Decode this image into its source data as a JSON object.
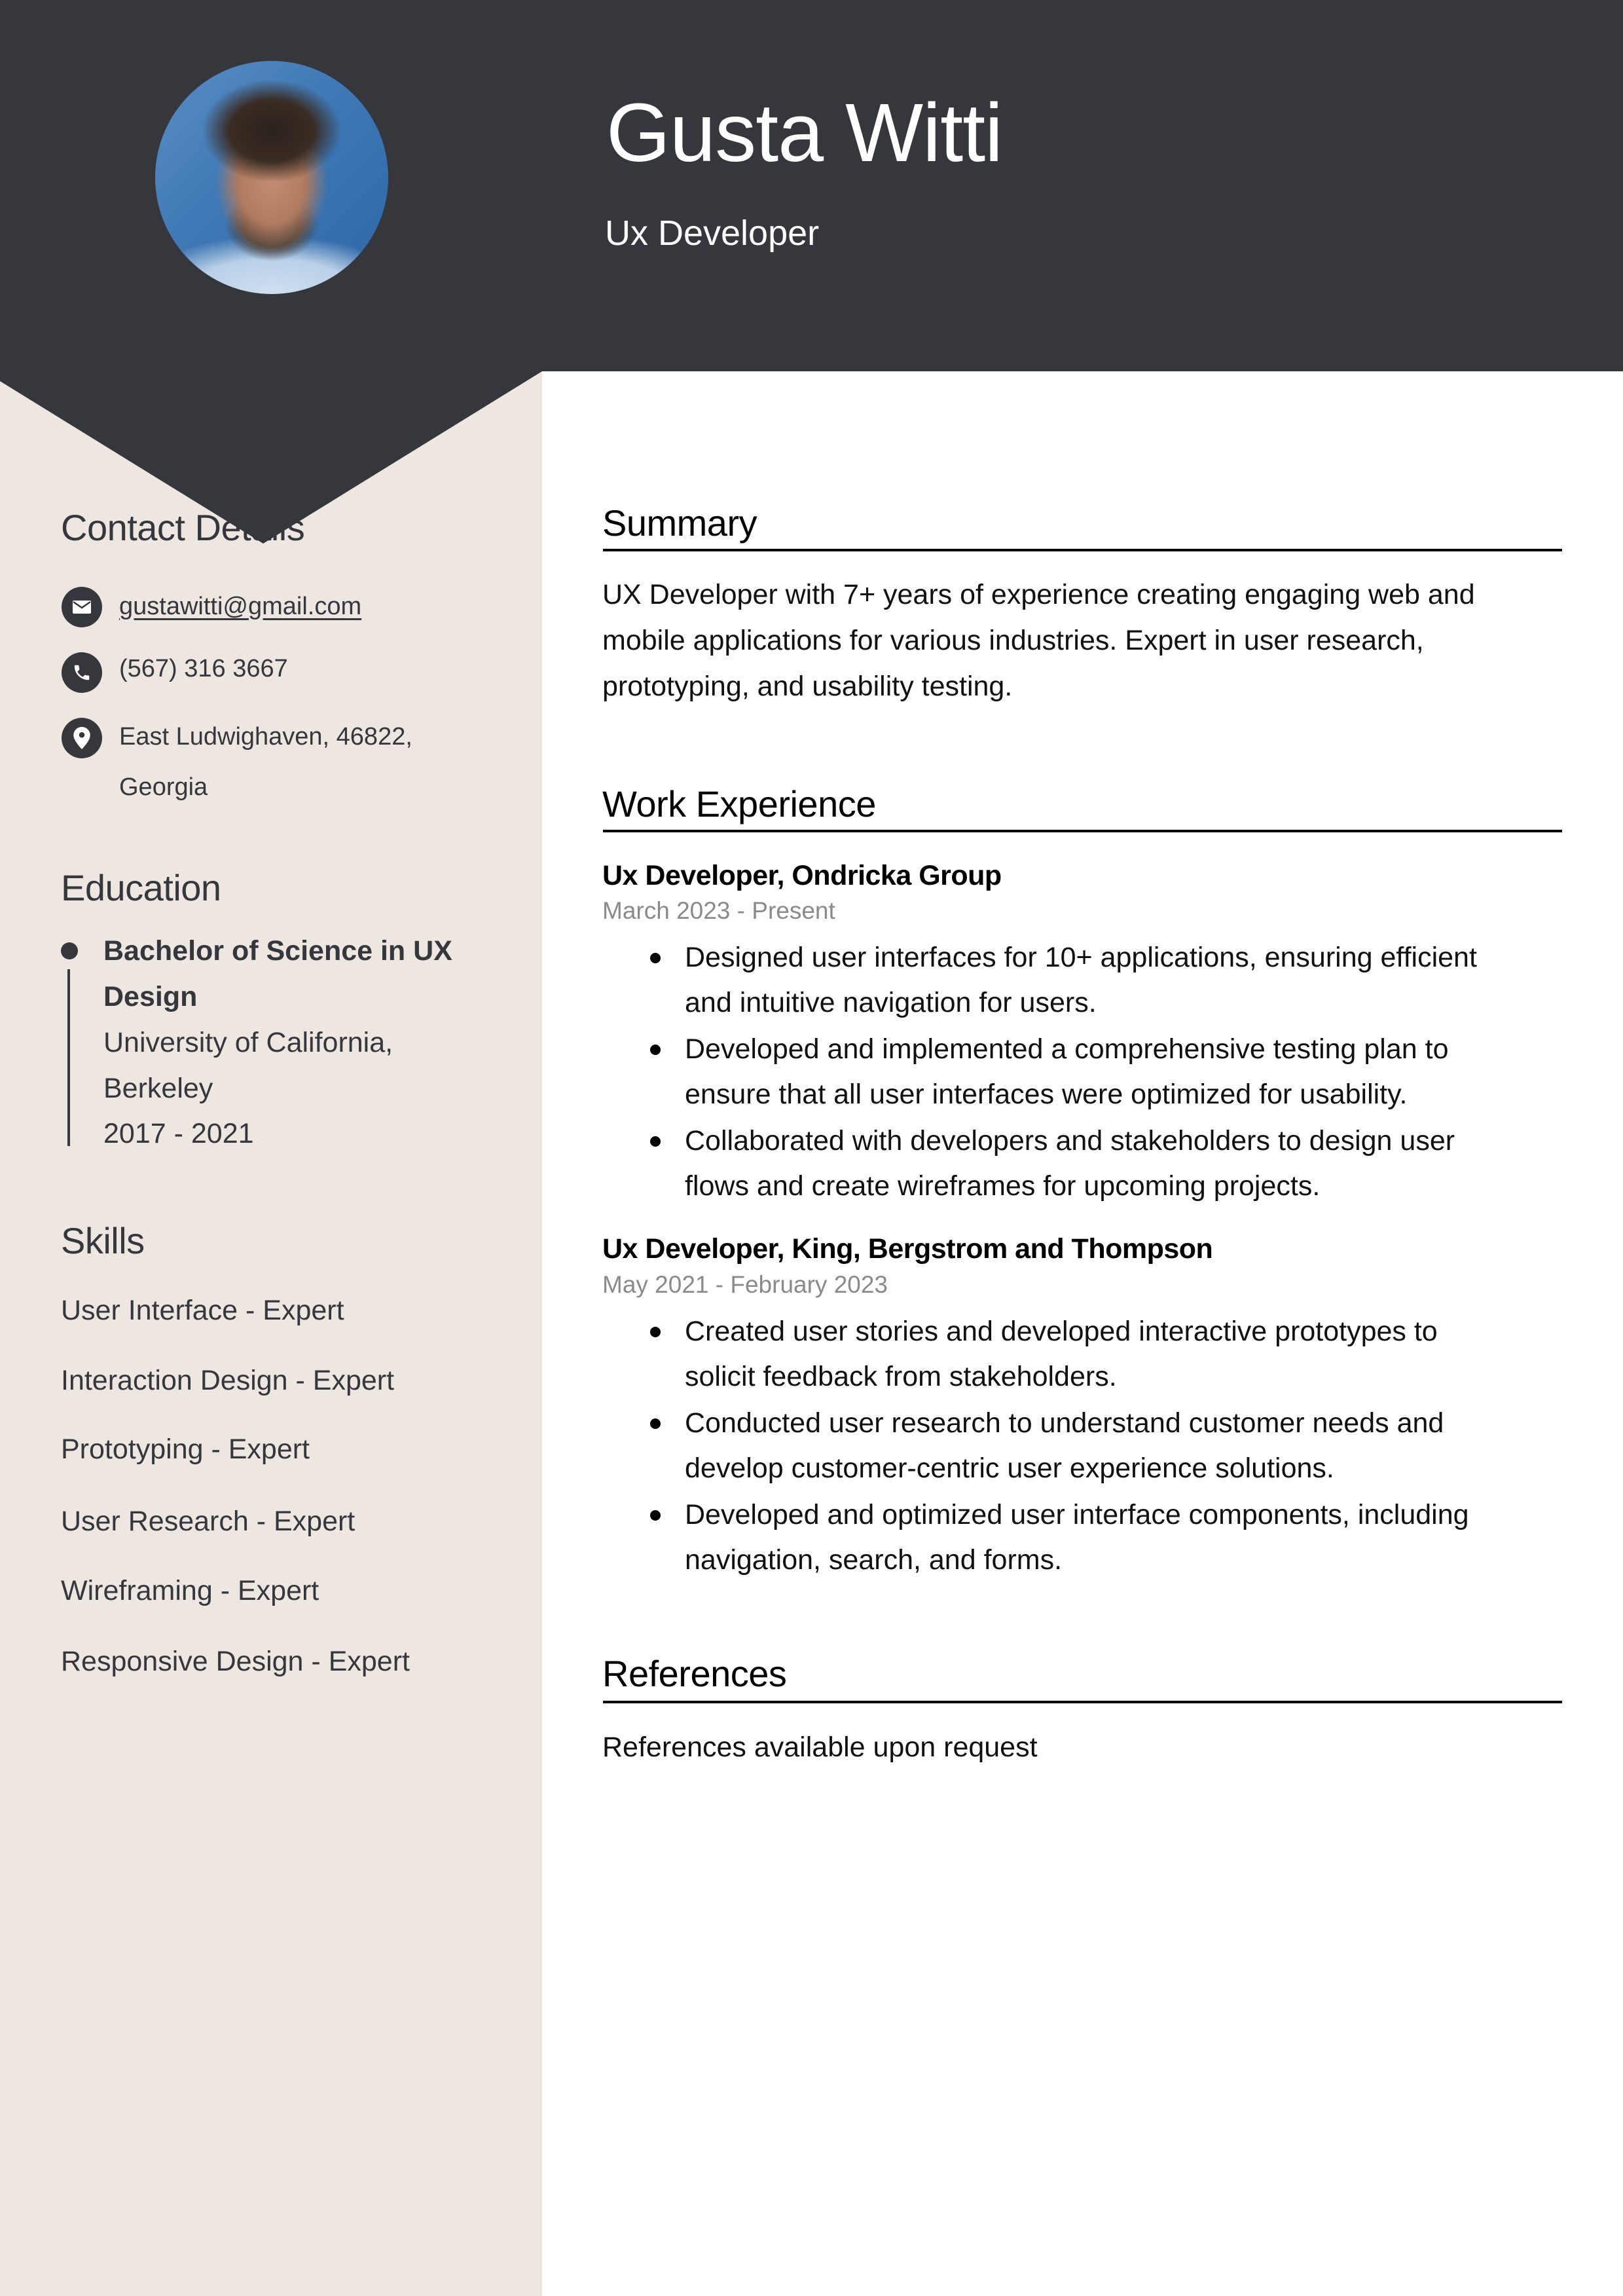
{
  "header": {
    "name": "Gusta Witti",
    "title": "Ux Developer",
    "photo_alt": "Profile photo of Gusta Witti"
  },
  "colors": {
    "header_bg": "#36373d",
    "sidebar_bg": "#ede6e1",
    "text_dark": "#36373d",
    "date_gray": "#8a8a8a"
  },
  "sidebar": {
    "contact": {
      "heading": "Contact Details",
      "items": [
        {
          "icon": "envelope-icon",
          "text": "gustawitti@gmail.com",
          "is_link": true
        },
        {
          "icon": "phone-icon",
          "text": "(567) 316 3667",
          "is_link": false
        },
        {
          "icon": "map-pin-icon",
          "lines": [
            "East Ludwighaven, 46822,",
            "Georgia"
          ],
          "is_link": false
        }
      ]
    },
    "education": {
      "heading": "Education",
      "entries": [
        {
          "degree_lines": [
            "Bachelor of Science in UX",
            "Design"
          ],
          "school_lines": [
            "University of California,",
            "Berkeley"
          ],
          "years": "2017 - 2021"
        }
      ]
    },
    "skills": {
      "heading": "Skills",
      "items": [
        "User Interface - Expert",
        "Interaction Design - Expert",
        "Prototyping - Expert",
        "User Research - Expert",
        "Wireframing - Expert",
        "Responsive Design - Expert"
      ]
    }
  },
  "main": {
    "summary": {
      "heading": "Summary",
      "lines": [
        "UX Developer with 7+ years of experience creating engaging web and",
        "mobile applications for various industries. Expert in user research,",
        "prototyping, and usability testing."
      ]
    },
    "experience": {
      "heading": "Work Experience",
      "jobs": [
        {
          "title": "Ux Developer, Ondricka Group",
          "dates": "March 2023 - Present",
          "bullets": [
            [
              "Designed user interfaces for 10+ applications, ensuring efficient",
              "and intuitive navigation for users."
            ],
            [
              "Developed and implemented a comprehensive testing plan to",
              "ensure that all user interfaces were optimized for usability."
            ],
            [
              "Collaborated with developers and stakeholders to design user",
              "flows and create wireframes for upcoming projects."
            ]
          ]
        },
        {
          "title": "Ux Developer, King, Bergstrom and Thompson",
          "dates": "May 2021 - February 2023",
          "bullets": [
            [
              "Created user stories and developed interactive prototypes to",
              "solicit feedback from stakeholders."
            ],
            [
              "Conducted user research to understand customer needs and",
              "develop customer-centric user experience solutions."
            ],
            [
              "Developed and optimized user interface components, including",
              "navigation, search, and forms."
            ]
          ]
        }
      ]
    },
    "references": {
      "heading": "References",
      "text": "References available upon request"
    }
  }
}
